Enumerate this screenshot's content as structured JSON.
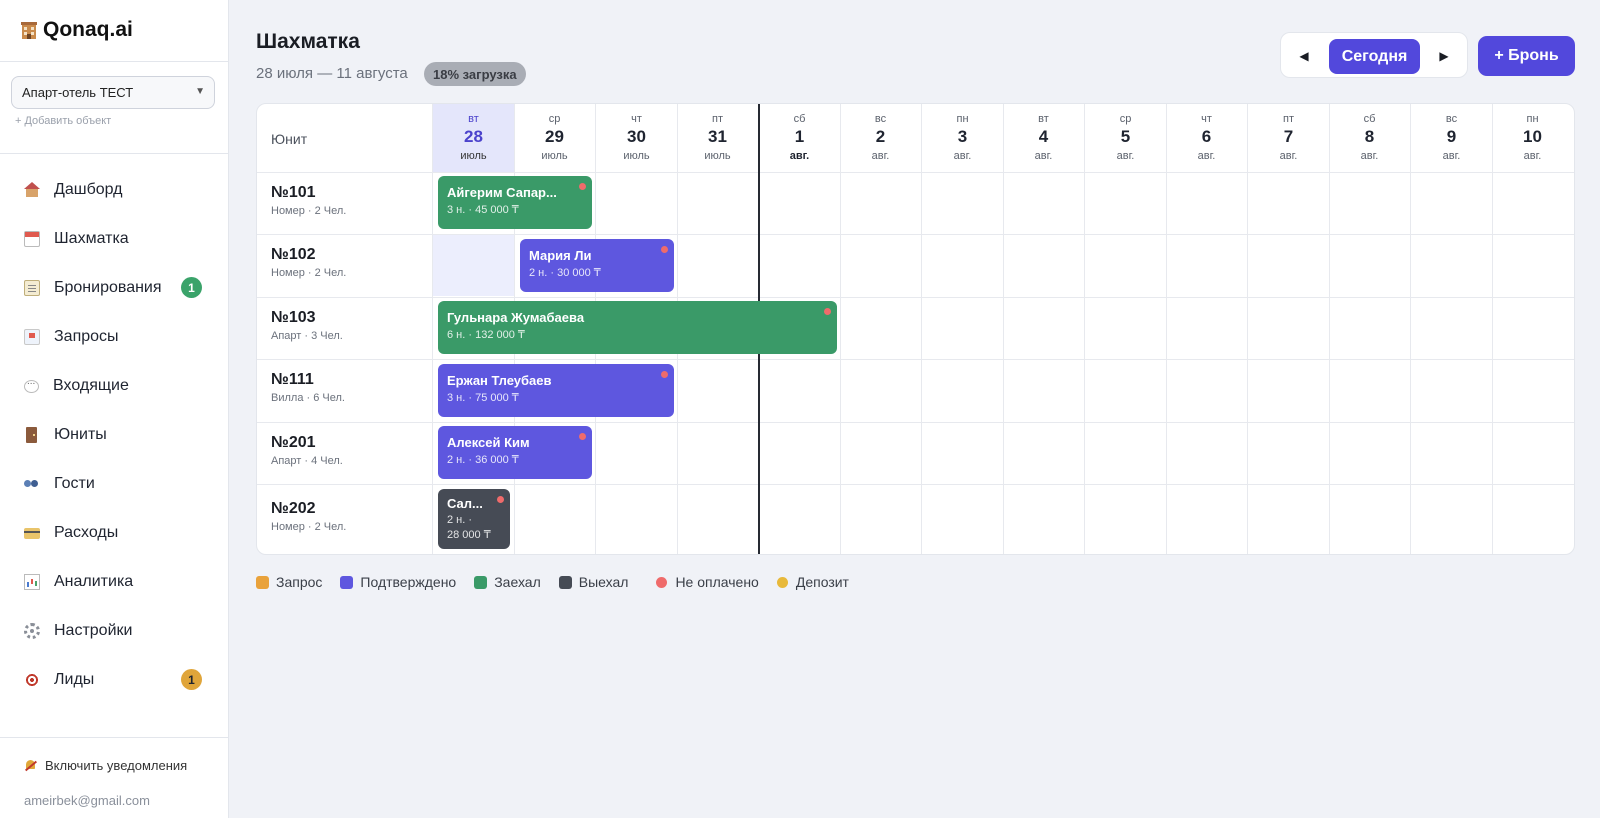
{
  "app": {
    "name": "Qonaq.ai"
  },
  "sidebar": {
    "property": "Апарт-отель ТЕСТ",
    "add_property": "+ Добавить объект",
    "items": [
      {
        "label": "Дашборд",
        "icon": "house-icon"
      },
      {
        "label": "Шахматка",
        "icon": "calendar-icon"
      },
      {
        "label": "Бронирования",
        "icon": "ledger-icon",
        "badge": "1",
        "badge_color": "#3aa36a"
      },
      {
        "label": "Запросы",
        "icon": "inbox-icon"
      },
      {
        "label": "Входящие",
        "icon": "chat-icon"
      },
      {
        "label": "Юниты",
        "icon": "door-icon"
      },
      {
        "label": "Гости",
        "icon": "users-icon"
      },
      {
        "label": "Расходы",
        "icon": "credit-card-icon"
      },
      {
        "label": "Аналитика",
        "icon": "bar-chart-icon"
      },
      {
        "label": "Настройки",
        "icon": "gear-icon"
      },
      {
        "label": "Лиды",
        "icon": "target-icon",
        "badge": "1",
        "badge_color": "#e0a53a"
      }
    ],
    "notifications": "Включить уведомления",
    "email": "ameirbek@gmail.com"
  },
  "header": {
    "title": "Шахматка",
    "range": "28 июля — 11 августа",
    "load": "18% загрузка",
    "prev": "◀",
    "today": "Сегодня",
    "next": "▶",
    "new_booking": "+ Бронь"
  },
  "grid": {
    "unit_header": "Юнит",
    "days": [
      {
        "dow": "вт",
        "num": "28",
        "mon": "июль"
      },
      {
        "dow": "ср",
        "num": "29",
        "mon": "июль"
      },
      {
        "dow": "чт",
        "num": "30",
        "mon": "июль"
      },
      {
        "dow": "пт",
        "num": "31",
        "mon": "июль"
      },
      {
        "dow": "сб",
        "num": "1",
        "mon": "авг."
      },
      {
        "dow": "вс",
        "num": "2",
        "mon": "авг."
      },
      {
        "dow": "пн",
        "num": "3",
        "mon": "авг."
      },
      {
        "dow": "вт",
        "num": "4",
        "mon": "авг."
      },
      {
        "dow": "ср",
        "num": "5",
        "mon": "авг."
      },
      {
        "dow": "чт",
        "num": "6",
        "mon": "авг."
      },
      {
        "dow": "пт",
        "num": "7",
        "mon": "авг."
      },
      {
        "dow": "сб",
        "num": "8",
        "mon": "авг."
      },
      {
        "dow": "вс",
        "num": "9",
        "mon": "авг."
      },
      {
        "dow": "пн",
        "num": "10",
        "mon": "авг."
      }
    ],
    "units": [
      {
        "name": "№101",
        "sub": "Номер · 2 Чел."
      },
      {
        "name": "№102",
        "sub": "Номер · 2 Чел."
      },
      {
        "name": "№103",
        "sub": "Апарт · 3 Чел."
      },
      {
        "name": "№111",
        "sub": "Вилла · 6 Чел."
      },
      {
        "name": "№201",
        "sub": "Апарт · 4 Чел."
      },
      {
        "name": "№202",
        "sub": "Номер · 2 Чел."
      }
    ],
    "bookings": [
      {
        "guest": "Айгерим Сапар...",
        "info": "3 н. · 45 000 ₸",
        "status": "Заехал",
        "unpaid": true
      },
      {
        "guest": "Мария Ли",
        "info": "2 н. · 30 000 ₸",
        "status": "Подтверждено",
        "unpaid": true
      },
      {
        "guest": "Гульнара Жумабаева",
        "info": "6 н. · 132 000 ₸",
        "status": "Заехал",
        "unpaid": true
      },
      {
        "guest": "Ержан Тлеубаев",
        "info": "3 н. · 75 000 ₸",
        "status": "Подтверждено",
        "unpaid": true
      },
      {
        "guest": "Алексей Ким",
        "info": "2 н. · 36 000 ₸",
        "status": "Подтверждено",
        "unpaid": true
      },
      {
        "guest": "Сал...",
        "info": "2 н. ·",
        "info2": "28 000 ₸",
        "status": "Выехал",
        "unpaid": true
      }
    ]
  },
  "legend": {
    "items": [
      {
        "label": "Запрос",
        "color": "#e9a23b",
        "shape": "square"
      },
      {
        "label": "Подтверждено",
        "color": "#5e57df",
        "shape": "square"
      },
      {
        "label": "Заехал",
        "color": "#3a9a68",
        "shape": "square"
      },
      {
        "label": "Выехал",
        "color": "#464b55",
        "shape": "square"
      },
      {
        "label": "Не оплачено",
        "color": "#ef6b6b",
        "shape": "dot"
      },
      {
        "label": "Депозит",
        "color": "#e8b93a",
        "shape": "dot"
      }
    ]
  }
}
